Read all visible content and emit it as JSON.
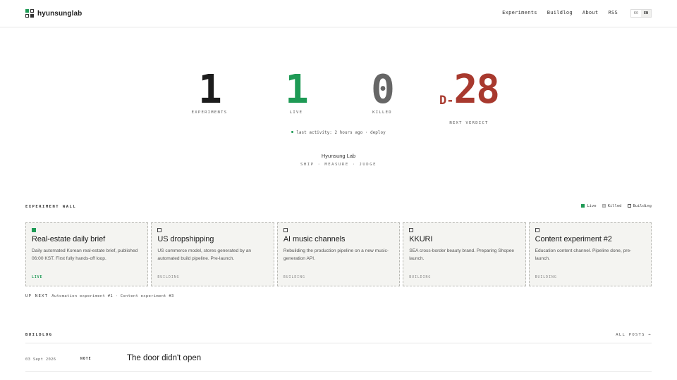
{
  "header": {
    "brand": "hyunsunglab",
    "nav": [
      "Experiments",
      "Buildlog",
      "About",
      "RSS"
    ],
    "lang": [
      "KO",
      "EN"
    ],
    "lang_active": "EN"
  },
  "stats": [
    {
      "value": "1",
      "label": "EXPERIMENTS",
      "color": "#1c1c1c"
    },
    {
      "value": "1",
      "label": "LIVE",
      "color": "#1e9a55"
    },
    {
      "value": "0",
      "label": "KILLED",
      "color": "#666666"
    },
    {
      "prefix": "D-",
      "value": "28",
      "label": "NEXT VERDICT",
      "color": "#a8392e"
    }
  ],
  "activity": "last activity: 2 hours ago · deploy",
  "lab_name": "Hyunsung Lab",
  "tagline": "SHIP · MEASURE · JUDGE",
  "wall": {
    "title": "EXPERIMENT WALL",
    "legend": [
      "Live",
      "Killed",
      "Building"
    ],
    "cards": [
      {
        "name": "Real-estate daily brief",
        "desc": "Daily automated Korean real-estate brief, published 06:00 KST. First fully hands-off loop.",
        "status": "LIVE",
        "live": true
      },
      {
        "name": "US dropshipping",
        "desc": "US commerce model, stores generated by an automated build pipeline. Pre-launch.",
        "status": "BUILDING",
        "live": false
      },
      {
        "name": "AI music channels",
        "desc": "Rebuilding the production pipeline on a new music-generation API.",
        "status": "BUILDING",
        "live": false
      },
      {
        "name": "KKURI",
        "desc": "SEA cross-border beauty brand. Preparing Shopee launch.",
        "status": "BUILDING",
        "live": false
      },
      {
        "name": "Content experiment #2",
        "desc": "Education content channel. Pipeline done, pre-launch.",
        "status": "BUILDING",
        "live": false
      }
    ],
    "up_next_label": "UP NEXT",
    "up_next": "Automation experiment #1 · Content experiment #3"
  },
  "buildlog": {
    "title": "BUILDLOG",
    "all_posts": "ALL POSTS →",
    "posts": [
      {
        "date": "03 Sept 2026",
        "type": "NOTE",
        "title": "The door didn't open"
      }
    ]
  }
}
